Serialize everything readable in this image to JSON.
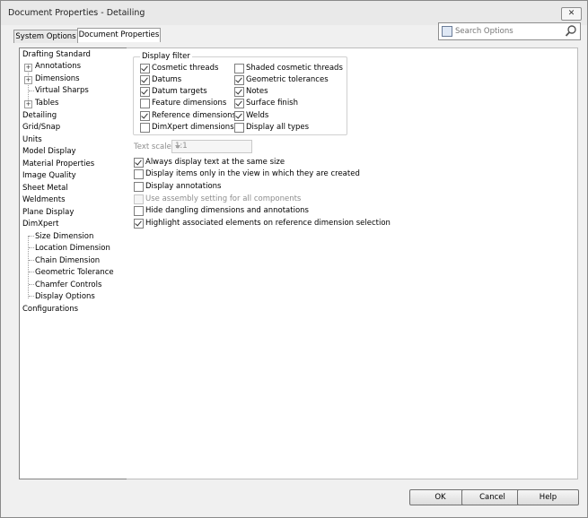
{
  "window": {
    "title": "Document Properties - Detailing",
    "close_glyph": "✕"
  },
  "tabs": [
    {
      "label": "System Options",
      "active": false
    },
    {
      "label": "Document Properties",
      "active": true
    }
  ],
  "search": {
    "placeholder": "Search Options",
    "icon": "magnifier-icon"
  },
  "tree": {
    "items": [
      {
        "label": "Drafting Standard"
      },
      {
        "label": "Annotations",
        "expander": "+"
      },
      {
        "label": "Dimensions",
        "expander": "+"
      },
      {
        "label": "Virtual Sharps"
      },
      {
        "label": "Tables",
        "expander": "+"
      },
      {
        "label": "Detailing"
      },
      {
        "label": "Grid/Snap"
      },
      {
        "label": "Units"
      },
      {
        "label": "Model Display"
      },
      {
        "label": "Material Properties"
      },
      {
        "label": "Image Quality"
      },
      {
        "label": "Sheet Metal"
      },
      {
        "label": "Weldments"
      },
      {
        "label": "Plane Display"
      },
      {
        "label": "DimXpert"
      },
      {
        "label": "Size Dimension"
      },
      {
        "label": "Location Dimension"
      },
      {
        "label": "Chain Dimension"
      },
      {
        "label": "Geometric Tolerance"
      },
      {
        "label": "Chamfer Controls"
      },
      {
        "label": "Display Options"
      },
      {
        "label": "Configurations"
      }
    ]
  },
  "display_filter": {
    "title": "Display filter",
    "left": [
      {
        "label": "Cosmetic threads",
        "checked": true
      },
      {
        "label": "Datums",
        "checked": true
      },
      {
        "label": "Datum targets",
        "checked": true
      },
      {
        "label": "Feature dimensions",
        "checked": false
      },
      {
        "label": "Reference dimensions",
        "checked": true
      },
      {
        "label": "DimXpert dimensions",
        "checked": false
      }
    ],
    "right": [
      {
        "label": "Shaded cosmetic threads",
        "checked": false
      },
      {
        "label": "Geometric tolerances",
        "checked": true
      },
      {
        "label": "Notes",
        "checked": true
      },
      {
        "label": "Surface finish",
        "checked": true
      },
      {
        "label": "Welds",
        "checked": true
      },
      {
        "label": "Display all types",
        "checked": false
      }
    ]
  },
  "text_scale": {
    "label": "Text scale:",
    "value": "1:1"
  },
  "options": [
    {
      "label": "Always display text at the same size",
      "checked": true,
      "disabled": false
    },
    {
      "label": "Display items only in the view in which they are created",
      "checked": false,
      "disabled": false
    },
    {
      "label": "Display annotations",
      "checked": false,
      "disabled": false
    },
    {
      "label": "Use assembly setting for all components",
      "checked": false,
      "disabled": true
    },
    {
      "label": "Hide dangling dimensions and annotations",
      "checked": false,
      "disabled": false
    },
    {
      "label": "Highlight associated elements on reference dimension selection",
      "checked": true,
      "disabled": false
    }
  ],
  "buttons": {
    "ok": "OK",
    "cancel": "Cancel",
    "help": "Help"
  }
}
